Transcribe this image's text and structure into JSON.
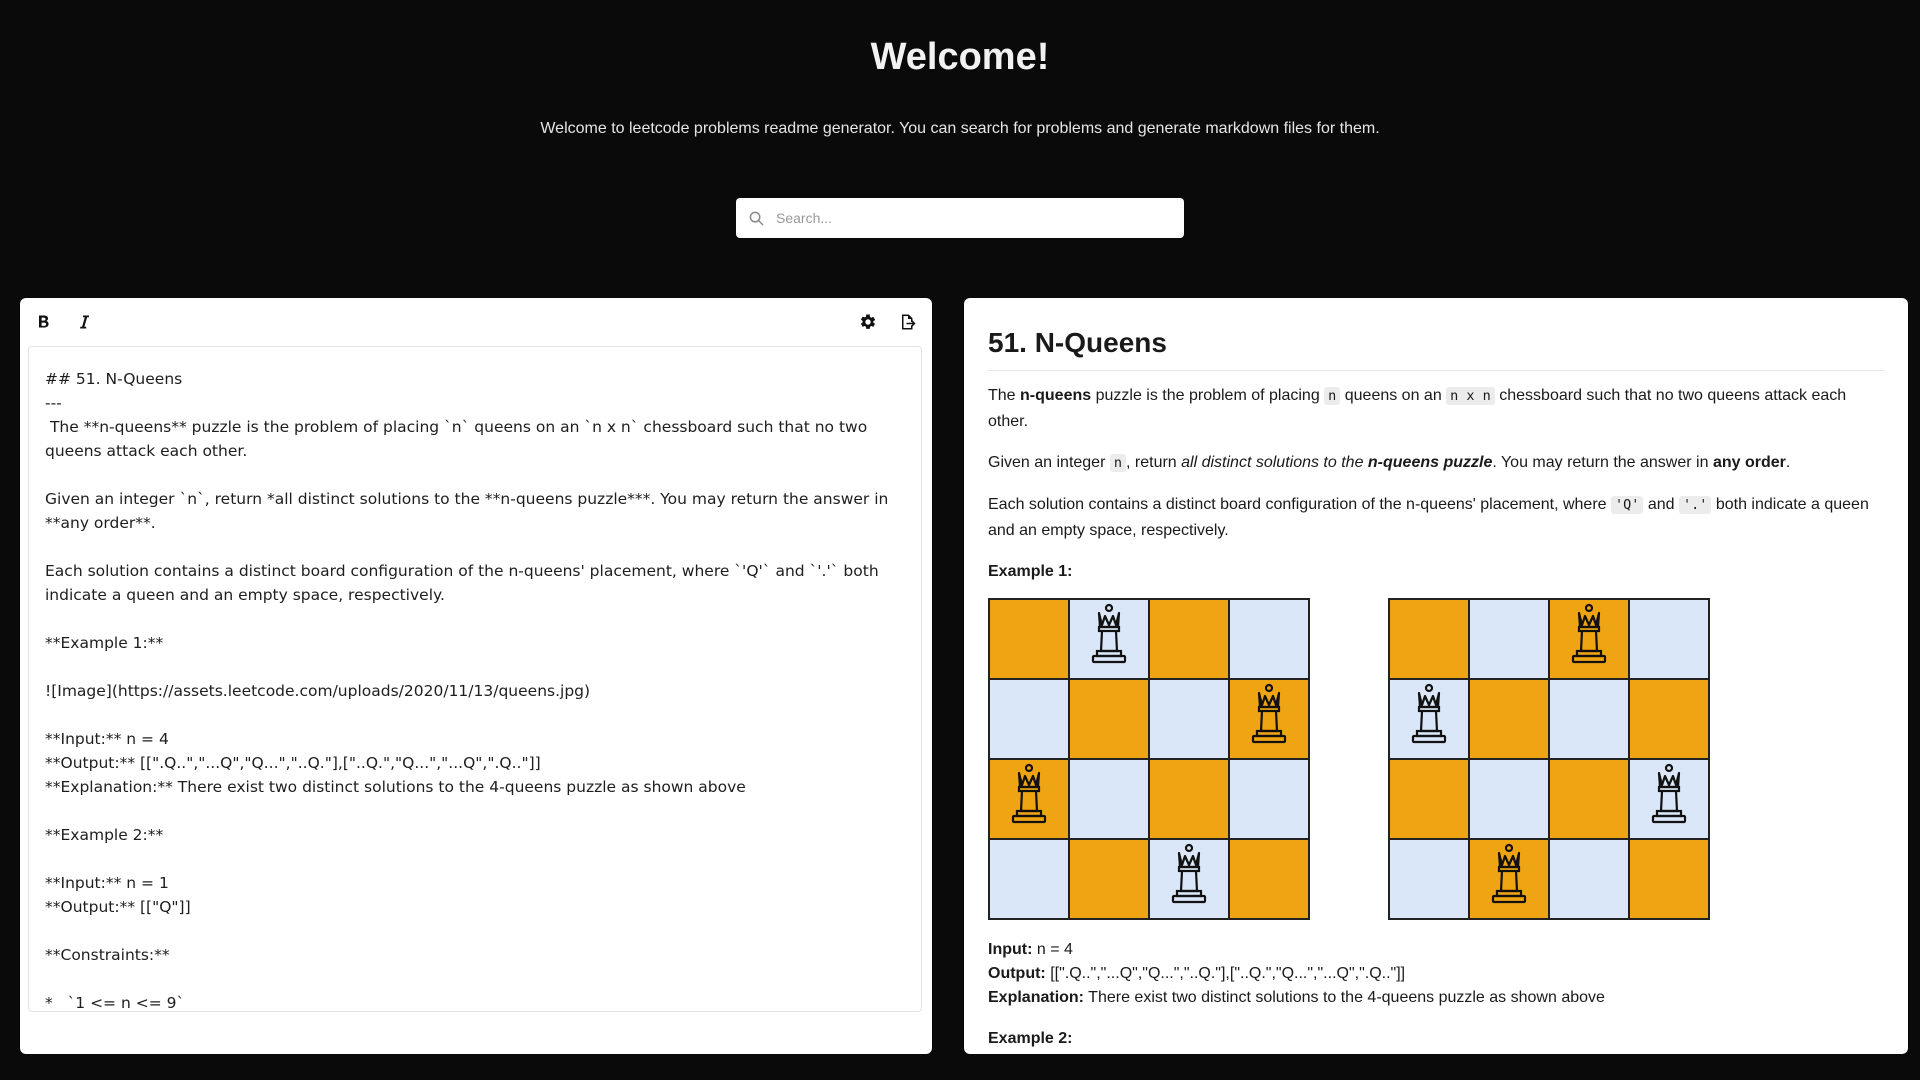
{
  "hero": {
    "title": "Welcome!",
    "subtitle": "Welcome to leetcode problems readme generator. You can search for problems and generate markdown files for them."
  },
  "search": {
    "placeholder": "Search...",
    "value": ""
  },
  "toolbar": {
    "bold_label": "B",
    "italic_label": "I",
    "icons": [
      "bold-icon",
      "italic-icon",
      "gear-icon",
      "export-file-icon"
    ]
  },
  "editor": {
    "content": "## 51. N-Queens\n---\n The **n-queens** puzzle is the problem of placing `n` queens on an `n x n` chessboard such that no two queens attack each other.\n\nGiven an integer `n`, return *all distinct solutions to the **n-queens puzzle***. You may return the answer in **any order**.\n\nEach solution contains a distinct board configuration of the n-queens' placement, where `'Q'` and `'.'` both indicate a queen and an empty space, respectively.\n\n**Example 1:**\n\n![Image](https://assets.leetcode.com/uploads/2020/11/13/queens.jpg)\n\n**Input:** n = 4\n**Output:** [[\".Q..\",\"...Q\",\"Q...\",\"..Q.\"],[\"..Q.\",\"Q...\",\"...Q\",\".Q..\"]]\n**Explanation:** There exist two distinct solutions to the 4-queens puzzle as shown above\n\n**Example 2:**\n\n**Input:** n = 1\n**Output:** [[\"Q\"]]\n\n**Constraints:**\n\n*   `1 <= n <= 9`"
  },
  "preview": {
    "title": "51. N-Queens",
    "p1": {
      "t1": "The ",
      "b1": "n-queens",
      "t2": " puzzle is the problem of placing ",
      "c1": "n",
      "t3": " queens on an ",
      "c2": "n x n",
      "t4": " chessboard such that no two queens attack each other."
    },
    "p2": {
      "t1": "Given an integer ",
      "c1": "n",
      "t2": ", return ",
      "i1": "all distinct solutions to the ",
      "bi1": "n-queens puzzle",
      "t3": ". You may return the answer in ",
      "b1": "any order",
      "t4": "."
    },
    "p3": {
      "t1": "Each solution contains a distinct board configuration of the n-queens' placement, where ",
      "c1": "'Q'",
      "t2": " and ",
      "c2": "'.'",
      "t3": " both indicate a queen and an empty space, respectively."
    },
    "example1_label": "Example 1:",
    "boards": [
      {
        "cells": [
          "o",
          "b",
          "o",
          "b",
          "b",
          "o",
          "b",
          "o",
          "o",
          "b",
          "o",
          "b",
          "b",
          "o",
          "b",
          "o"
        ],
        "queens": [
          1,
          7,
          8,
          14
        ]
      },
      {
        "cells": [
          "o",
          "b",
          "o",
          "b",
          "b",
          "o",
          "b",
          "o",
          "o",
          "b",
          "o",
          "b",
          "b",
          "o",
          "b",
          "o"
        ],
        "queens": [
          2,
          4,
          11,
          13
        ]
      }
    ],
    "colors": {
      "orange": "#eea413",
      "blue": "#d9e7f8"
    },
    "input_label": "Input:",
    "input_value": " n = 4",
    "output_label": "Output:",
    "output_value": " [[\".Q..\",\"...Q\",\"Q...\",\"..Q.\"],[\"..Q.\",\"Q...\",\"...Q\",\".Q..\"]]",
    "explanation_label": "Explanation:",
    "explanation_value": " There exist two distinct solutions to the 4-queens puzzle as shown above",
    "example2_label": "Example 2:"
  }
}
